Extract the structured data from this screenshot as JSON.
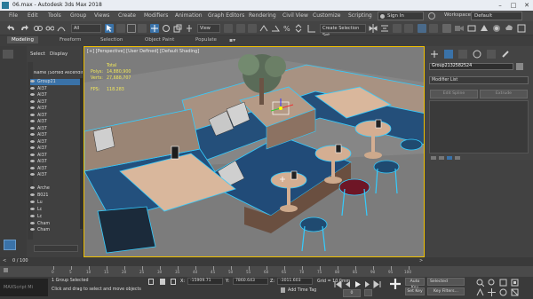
{
  "window": {
    "title": "06.max - Autodesk 3ds Max 2018",
    "app_icon": "3dsmax-app-icon",
    "controls": [
      "minimize-icon",
      "maximize-icon",
      "close-icon"
    ]
  },
  "menu": [
    "File",
    "Edit",
    "Tools",
    "Group",
    "Views",
    "Create",
    "Modifiers",
    "Animation",
    "Graph Editors",
    "Rendering",
    "Civil View",
    "Customize",
    "Scripting"
  ],
  "account": {
    "signin": "Sign In"
  },
  "workspace": {
    "label": "Workspaces:",
    "value": "Default"
  },
  "toolbar": {
    "selection_filter": "All",
    "view_ref": "View",
    "create_selection_set": "Create Selection Set"
  },
  "ribbon": {
    "tabs": [
      "Modeling",
      "Freeform",
      "Selection",
      "Object Paint",
      "Populate"
    ],
    "active": "Modeling"
  },
  "explorer": {
    "tabs": [
      "Select",
      "Display"
    ],
    "column": "Name (Sorted Ascending)",
    "rows": [
      "Group21",
      "AI37",
      "AI37",
      "AI37",
      "AI37",
      "AI37",
      "AI37",
      "AI37",
      "AI37",
      "AI37",
      "AI37",
      "AI37",
      "AI37",
      "AI37",
      "AI37",
      "Arche",
      "B021",
      "Lu",
      "Lc",
      "Lc",
      "Cham",
      "Cham"
    ],
    "highlighted": "Group21"
  },
  "viewport": {
    "label": "[+] [Perspective] [User Defined] [Default Shading]",
    "stats": {
      "total": "Total",
      "polys_label": "Polys:",
      "polys": "14,880,900",
      "verts_label": "Verts:",
      "verts": "27,688,707",
      "fps_label": "FPS:",
      "fps": "118.283"
    }
  },
  "command_panel": {
    "object_name": "Group2132582524",
    "modifier_list": "Modifier List",
    "edit_geometry": "Edit Spline",
    "extrude": "Extrude",
    "accent_color": "#3a72a8"
  },
  "timeline": {
    "frame": "0 / 100",
    "ticks": [
      "0",
      "5",
      "10",
      "15",
      "20",
      "25",
      "30",
      "35",
      "40",
      "45",
      "50",
      "55",
      "60",
      "65",
      "70",
      "75",
      "80",
      "85",
      "90",
      "95",
      "100"
    ]
  },
  "status": {
    "maxscript": "MAXScript Mi",
    "selection": "1 Group Selected",
    "prompt": "Click and drag to select and move objects",
    "x_label": "X:",
    "x": "-15909.71",
    "y_label": "Y:",
    "y": "7860.643",
    "z_label": "Z:",
    "z": "-3011.603",
    "grid": "Grid = 10.0mm",
    "add_time_tag": "Add Time Tag",
    "auto_key": "Auto Key",
    "selected": "Selected",
    "set_key": "Set Key",
    "key_filters": "Key Filters...",
    "frame_field": "0"
  }
}
